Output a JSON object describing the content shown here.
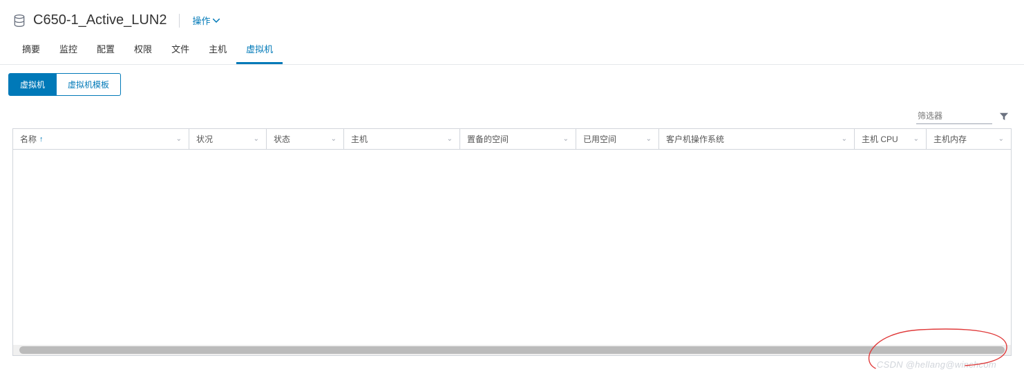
{
  "header": {
    "title": "C650-1_Active_LUN2",
    "actions_label": "操作"
  },
  "tabs": [
    {
      "label": "摘要",
      "active": false
    },
    {
      "label": "监控",
      "active": false
    },
    {
      "label": "配置",
      "active": false
    },
    {
      "label": "权限",
      "active": false
    },
    {
      "label": "文件",
      "active": false
    },
    {
      "label": "主机",
      "active": false
    },
    {
      "label": "虚拟机",
      "active": true
    }
  ],
  "subtabs": {
    "vm": "虚拟机",
    "vm_template": "虚拟机模板"
  },
  "filter": {
    "placeholder": "筛选器"
  },
  "columns": [
    {
      "label": "名称",
      "sort": "asc",
      "key": "name"
    },
    {
      "label": "状况",
      "key": "status1"
    },
    {
      "label": "状态",
      "key": "status2"
    },
    {
      "label": "主机",
      "key": "host"
    },
    {
      "label": "置备的空间",
      "key": "provisioned"
    },
    {
      "label": "已用空间",
      "key": "used"
    },
    {
      "label": "客户机操作系统",
      "key": "guest"
    },
    {
      "label": "主机 CPU",
      "key": "cpu"
    },
    {
      "label": "主机内存",
      "key": "mem"
    }
  ],
  "rows": [],
  "watermark": "CSDN @hellang@winchcom"
}
